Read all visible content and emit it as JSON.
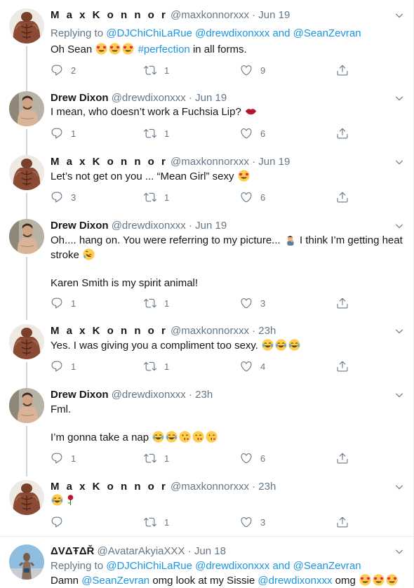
{
  "tweets": [
    {
      "name": "M a x  K o n n o r",
      "handle": "@maxkonnorxxx",
      "dot": "·",
      "time": "Jun 19",
      "replying_prefix": "Replying to",
      "replying_1": "@DJChiChiLaRue",
      "replying_2": "@drewdixonxxx",
      "replying_and": "and",
      "replying_3": "@SeanZevran",
      "text_a": "Oh Sean",
      "hashtag": "#perfection",
      "text_b": "in all forms.",
      "replies": "2",
      "retweets": "1",
      "likes": "9"
    },
    {
      "name": "Drew Dixon",
      "handle": "@drewdixonxxx",
      "dot": "·",
      "time": "Jun 19",
      "text": "I mean, who doesn’t work a Fuchsia Lip?",
      "replies": "1",
      "retweets": "1",
      "likes": "6"
    },
    {
      "name": "M a x  K o n n o r",
      "handle": "@maxkonnorxxx",
      "dot": "·",
      "time": "Jun 19",
      "text": "Let’s not get on you ... “Mean Girl” sexy",
      "replies": "3",
      "retweets": "1",
      "likes": "6"
    },
    {
      "name": "Drew Dixon",
      "handle": "@drewdixonxxx",
      "dot": "·",
      "time": "Jun 19",
      "text_1a": "Oh.... hang on. You were referring to my picture...",
      "text_1b": "I think I’m getting heat",
      "text_2": "stroke",
      "text_3": "Karen Smith is my spirit animal!",
      "replies": "1",
      "retweets": "1",
      "likes": "3"
    },
    {
      "name": "M a x  K o n n o r",
      "handle": "@maxkonnorxxx",
      "dot": "·",
      "time": "23h",
      "text": "Yes.  I was giving you a compliment too sexy.",
      "replies": "1",
      "retweets": "1",
      "likes": "4"
    },
    {
      "name": "Drew Dixon",
      "handle": "@drewdixonxxx",
      "dot": "·",
      "time": "23h",
      "text_1": "Fml.",
      "text_2": "I’m gonna take a nap",
      "replies": "1",
      "retweets": "1",
      "likes": "6"
    },
    {
      "name": "M a x  K o n n o r",
      "handle": "@maxkonnorxxx",
      "dot": "·",
      "time": "23h",
      "replies": "",
      "retweets": "1",
      "likes": "3"
    },
    {
      "name": "ΔVΔŦΔŘ",
      "handle": "@AvatarAkyiaXXX",
      "dot": "·",
      "time": "Jun 18",
      "replying_prefix": "Replying to",
      "replying_1": "@DJChiChiLaRue",
      "replying_2": "@drewdixonxxx",
      "replying_and": "and",
      "replying_3": "@SeanZevran",
      "text_a": "Damn",
      "mention_a": "@SeanZevran",
      "text_b": "omg look at my Sissie",
      "mention_b": "@drewdixonxxx",
      "text_c": "omg"
    }
  ],
  "colors": {
    "link": "#1b95e0",
    "muted": "#657786",
    "line": "#ccd6dd"
  }
}
